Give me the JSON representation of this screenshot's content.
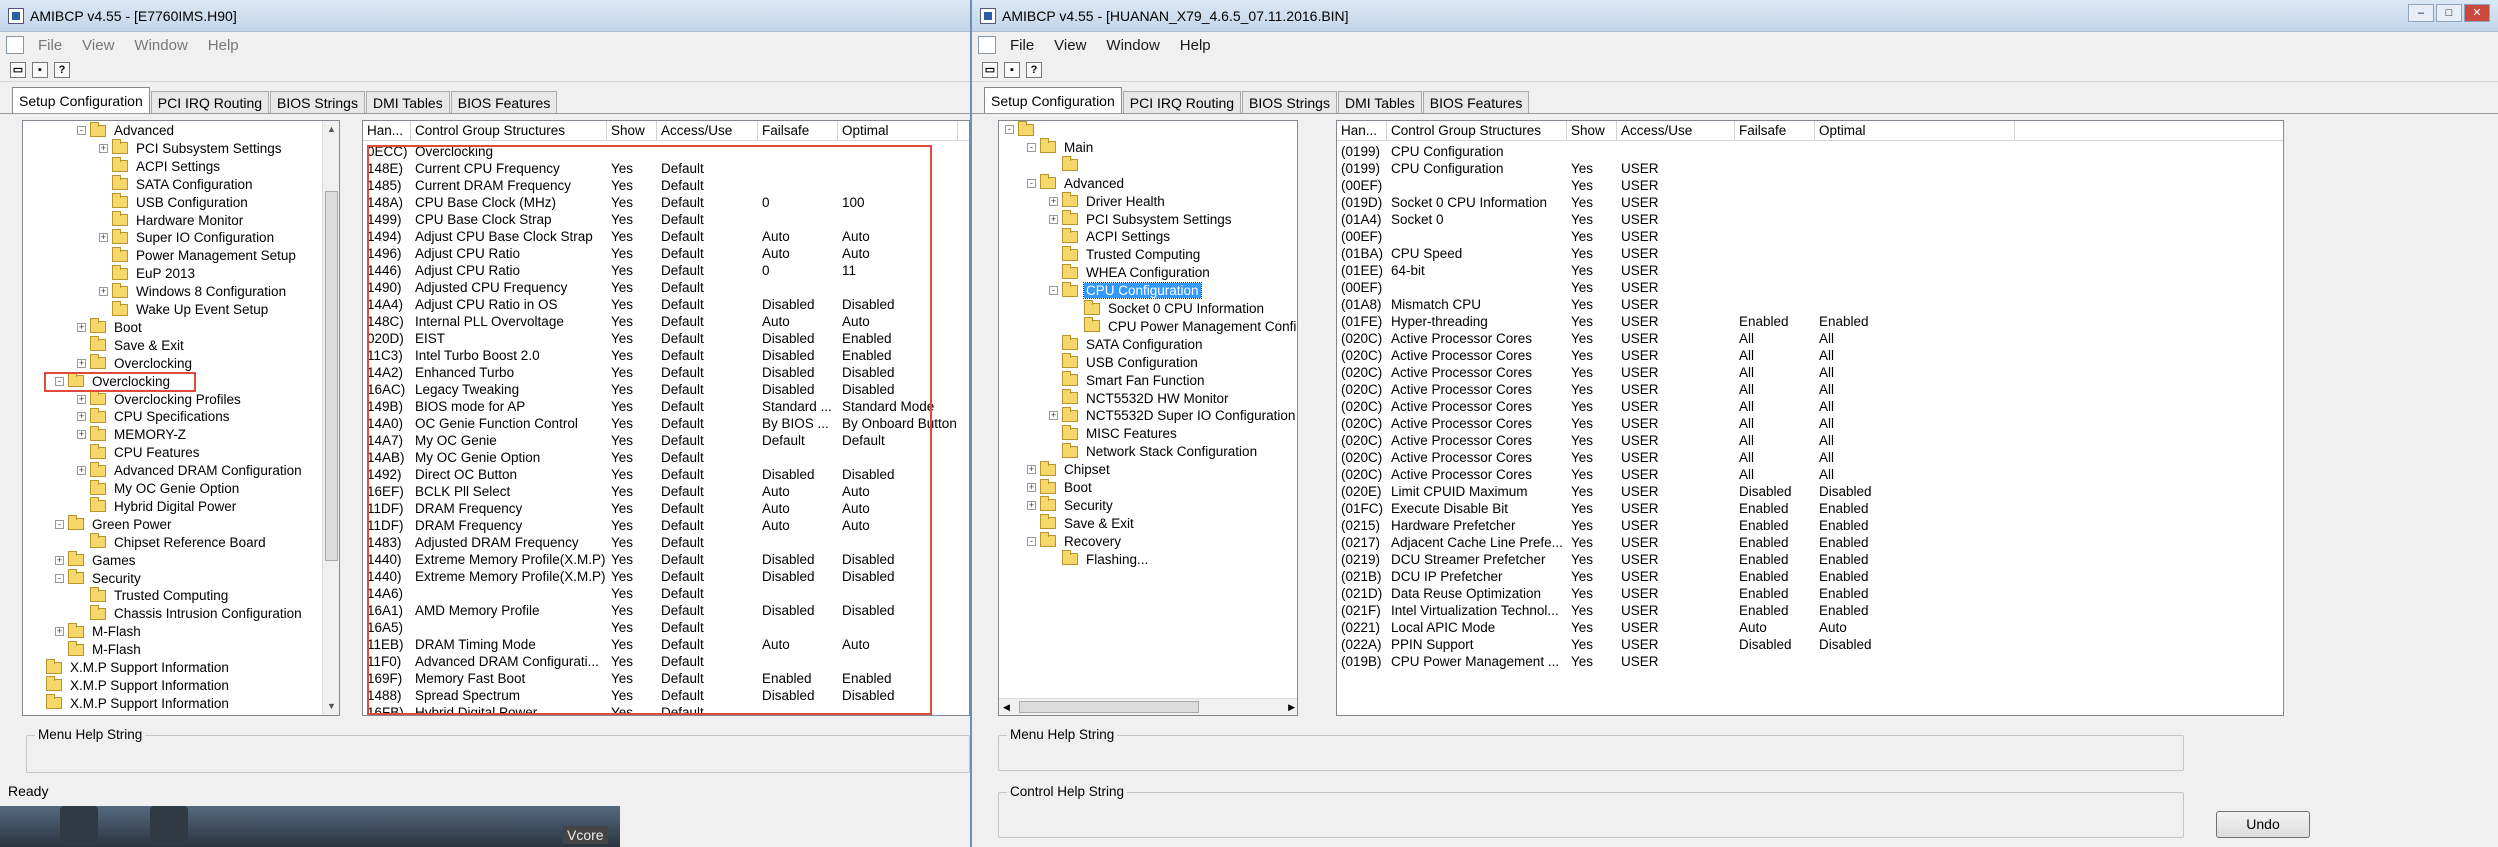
{
  "win1": {
    "title": "AMIBCP v4.55 - [E7760IMS.H90]",
    "menu": [
      "File",
      "View",
      "Window",
      "Help"
    ],
    "tabs": [
      "Setup Configuration",
      "PCI IRQ Routing",
      "BIOS Strings",
      "DMI Tables",
      "BIOS Features"
    ],
    "tree": [
      {
        "label": "Advanced",
        "level": 2,
        "exp": "-"
      },
      {
        "label": "PCI Subsystem Settings",
        "level": 3,
        "exp": "+"
      },
      {
        "label": "ACPI Settings",
        "level": 3,
        "exp": ""
      },
      {
        "label": "SATA Configuration",
        "level": 3,
        "exp": ""
      },
      {
        "label": "USB Configuration",
        "level": 3,
        "exp": ""
      },
      {
        "label": "Hardware Monitor",
        "level": 3,
        "exp": ""
      },
      {
        "label": "Super IO Configuration",
        "level": 3,
        "exp": "+"
      },
      {
        "label": "Power Management Setup",
        "level": 3,
        "exp": ""
      },
      {
        "label": "EuP 2013",
        "level": 3,
        "exp": ""
      },
      {
        "label": "Windows 8 Configuration",
        "level": 3,
        "exp": "+"
      },
      {
        "label": "Wake Up Event Setup",
        "level": 3,
        "exp": ""
      },
      {
        "label": "Boot",
        "level": 2,
        "exp": "+"
      },
      {
        "label": "Save & Exit",
        "level": 2,
        "exp": ""
      },
      {
        "label": "Overclocking",
        "level": 2,
        "exp": "+"
      },
      {
        "label": "Overclocking",
        "level": 1,
        "exp": "-"
      },
      {
        "label": "Overclocking Profiles",
        "level": 2,
        "exp": "+"
      },
      {
        "label": "CPU Specifications",
        "level": 2,
        "exp": "+"
      },
      {
        "label": "MEMORY-Z",
        "level": 2,
        "exp": "+"
      },
      {
        "label": "CPU Features",
        "level": 2,
        "exp": ""
      },
      {
        "label": "Advanced DRAM Configuration",
        "level": 2,
        "exp": "+"
      },
      {
        "label": "My OC Genie Option",
        "level": 2,
        "exp": ""
      },
      {
        "label": "Hybrid Digital Power",
        "level": 2,
        "exp": ""
      },
      {
        "label": "Green Power",
        "level": 1,
        "exp": "-"
      },
      {
        "label": "Chipset Reference Board",
        "level": 2,
        "exp": ""
      },
      {
        "label": "Games",
        "level": 1,
        "exp": "+"
      },
      {
        "label": "Security",
        "level": 1,
        "exp": "-"
      },
      {
        "label": "Trusted Computing",
        "level": 2,
        "exp": ""
      },
      {
        "label": "Chassis Intrusion Configuration",
        "level": 2,
        "exp": ""
      },
      {
        "label": "M-Flash",
        "level": 1,
        "exp": "+"
      },
      {
        "label": "M-Flash",
        "level": 1,
        "exp": ""
      },
      {
        "label": "X.M.P Support Information",
        "level": 0,
        "exp": ""
      },
      {
        "label": "X.M.P Support Information",
        "level": 0,
        "exp": ""
      },
      {
        "label": "X.M.P Support Information",
        "level": 0,
        "exp": ""
      }
    ],
    "columns": [
      "Han...",
      "Control Group Structures",
      "Show",
      "Access/Use",
      "Failsafe",
      "Optimal"
    ],
    "rows": [
      [
        "0ECC)",
        "Overclocking",
        "",
        "",
        "",
        ""
      ],
      [
        "148E)",
        "Current CPU Frequency",
        "Yes",
        "Default",
        "",
        ""
      ],
      [
        "1485)",
        "Current DRAM Frequency",
        "Yes",
        "Default",
        "",
        ""
      ],
      [
        "148A)",
        "CPU Base Clock (MHz)",
        "Yes",
        "Default",
        "0",
        "100"
      ],
      [
        "1499)",
        "CPU Base Clock Strap",
        "Yes",
        "Default",
        "",
        ""
      ],
      [
        "1494)",
        "Adjust CPU Base Clock Strap",
        "Yes",
        "Default",
        "Auto",
        "Auto"
      ],
      [
        "1496)",
        "Adjust CPU Ratio",
        "Yes",
        "Default",
        "Auto",
        "Auto"
      ],
      [
        "1446)",
        "Adjust CPU Ratio",
        "Yes",
        "Default",
        "0",
        "11"
      ],
      [
        "1490)",
        "Adjusted CPU Frequency",
        "Yes",
        "Default",
        "",
        ""
      ],
      [
        "14A4)",
        "Adjust CPU Ratio in OS",
        "Yes",
        "Default",
        "Disabled",
        "Disabled"
      ],
      [
        "148C)",
        "Internal PLL Overvoltage",
        "Yes",
        "Default",
        "Auto",
        "Auto"
      ],
      [
        "020D)",
        "EIST",
        "Yes",
        "Default",
        "Disabled",
        "Enabled"
      ],
      [
        "11C3)",
        "Intel Turbo Boost 2.0",
        "Yes",
        "Default",
        "Disabled",
        "Enabled"
      ],
      [
        "14A2)",
        "Enhanced Turbo",
        "Yes",
        "Default",
        "Disabled",
        "Disabled"
      ],
      [
        "16AC)",
        "Legacy Tweaking",
        "Yes",
        "Default",
        "Disabled",
        "Disabled"
      ],
      [
        "149B)",
        "BIOS mode for AP",
        "Yes",
        "Default",
        "Standard ...",
        "Standard Mode"
      ],
      [
        "14A0)",
        "OC Genie Function Control",
        "Yes",
        "Default",
        "By BIOS ...",
        "By Onboard Button"
      ],
      [
        "14A7)",
        "My OC Genie",
        "Yes",
        "Default",
        "Default",
        "Default"
      ],
      [
        "14AB)",
        "My OC Genie Option",
        "Yes",
        "Default",
        "",
        ""
      ],
      [
        "1492)",
        "Direct OC Button",
        "Yes",
        "Default",
        "Disabled",
        "Disabled"
      ],
      [
        "16EF)",
        "BCLK Pll Select",
        "Yes",
        "Default",
        "Auto",
        "Auto"
      ],
      [
        "11DF)",
        "DRAM Frequency",
        "Yes",
        "Default",
        "Auto",
        "Auto"
      ],
      [
        "11DF)",
        "DRAM Frequency",
        "Yes",
        "Default",
        "Auto",
        "Auto"
      ],
      [
        "1483)",
        "Adjusted DRAM Frequency",
        "Yes",
        "Default",
        "",
        ""
      ],
      [
        "1440)",
        "Extreme Memory Profile(X.M.P)",
        "Yes",
        "Default",
        "Disabled",
        "Disabled"
      ],
      [
        "1440)",
        "Extreme Memory Profile(X.M.P)",
        "Yes",
        "Default",
        "Disabled",
        "Disabled"
      ],
      [
        "14A6)",
        "",
        "Yes",
        "Default",
        "",
        ""
      ],
      [
        "16A1)",
        "AMD Memory Profile",
        "Yes",
        "Default",
        "Disabled",
        "Disabled"
      ],
      [
        "16A5)",
        "",
        "Yes",
        "Default",
        "",
        ""
      ],
      [
        "11EB)",
        "DRAM Timing Mode",
        "Yes",
        "Default",
        "Auto",
        "Auto"
      ],
      [
        "11F0)",
        "Advanced DRAM Configurati...",
        "Yes",
        "Default",
        "",
        ""
      ],
      [
        "169F)",
        "Memory Fast Boot",
        "Yes",
        "Default",
        "Enabled",
        "Enabled"
      ],
      [
        "1488)",
        "Spread Spectrum",
        "Yes",
        "Default",
        "Disabled",
        "Disabled"
      ],
      [
        "16FB)",
        "Hybrid Digital Power",
        "Yes",
        "Default",
        "",
        ""
      ]
    ],
    "menu_help_label": "Menu Help String",
    "status": "Ready",
    "taskbar_text": "Vcore"
  },
  "win2": {
    "title": "AMIBCP v4.55 - [HUANAN_X79_4.6.5_07.11.2016.BIN]",
    "menu": [
      "File",
      "View",
      "Window",
      "Help"
    ],
    "tabs": [
      "Setup Configuration",
      "PCI IRQ Routing",
      "BIOS Strings",
      "DMI Tables",
      "BIOS Features"
    ],
    "tree": [
      {
        "label": "",
        "level": 0,
        "exp": "-"
      },
      {
        "label": "Main",
        "level": 1,
        "exp": "-"
      },
      {
        "label": "",
        "level": 2,
        "exp": ""
      },
      {
        "label": "Advanced",
        "level": 1,
        "exp": "-"
      },
      {
        "label": "Driver Health",
        "level": 2,
        "exp": "+"
      },
      {
        "label": "PCI Subsystem Settings",
        "level": 2,
        "exp": "+"
      },
      {
        "label": "ACPI Settings",
        "level": 2,
        "exp": ""
      },
      {
        "label": "Trusted Computing",
        "level": 2,
        "exp": ""
      },
      {
        "label": "WHEA Configuration",
        "level": 2,
        "exp": ""
      },
      {
        "label": "CPU Configuration",
        "level": 2,
        "exp": "-",
        "selected": true
      },
      {
        "label": "Socket 0 CPU Information",
        "level": 3,
        "exp": ""
      },
      {
        "label": "CPU Power Management Configur",
        "level": 3,
        "exp": ""
      },
      {
        "label": "SATA Configuration",
        "level": 2,
        "exp": ""
      },
      {
        "label": "USB Configuration",
        "level": 2,
        "exp": ""
      },
      {
        "label": "Smart Fan Function",
        "level": 2,
        "exp": ""
      },
      {
        "label": "NCT5532D HW Monitor",
        "level": 2,
        "exp": ""
      },
      {
        "label": "NCT5532D Super IO Configuration",
        "level": 2,
        "exp": "+"
      },
      {
        "label": "MISC Features",
        "level": 2,
        "exp": ""
      },
      {
        "label": "Network Stack Configuration",
        "level": 2,
        "exp": ""
      },
      {
        "label": "Chipset",
        "level": 1,
        "exp": "+"
      },
      {
        "label": "Boot",
        "level": 1,
        "exp": "+"
      },
      {
        "label": "Security",
        "level": 1,
        "exp": "+"
      },
      {
        "label": "Save & Exit",
        "level": 1,
        "exp": ""
      },
      {
        "label": "Recovery",
        "level": 1,
        "exp": "-"
      },
      {
        "label": "Flashing...",
        "level": 2,
        "exp": ""
      }
    ],
    "columns": [
      "Han...",
      "Control Group Structures",
      "Show",
      "Access/Use",
      "Failsafe",
      "Optimal"
    ],
    "rows": [
      [
        "(0199)",
        "CPU Configuration",
        "",
        "",
        "",
        ""
      ],
      [
        "(0199)",
        "CPU Configuration",
        "Yes",
        "USER",
        "",
        ""
      ],
      [
        "(00EF)",
        "",
        "Yes",
        "USER",
        "",
        ""
      ],
      [
        "(019D)",
        "Socket 0 CPU Information",
        "Yes",
        "USER",
        "",
        ""
      ],
      [
        "(01A4)",
        "Socket 0",
        "Yes",
        "USER",
        "",
        ""
      ],
      [
        "(00EF)",
        "",
        "Yes",
        "USER",
        "",
        ""
      ],
      [
        "(01BA)",
        "CPU Speed",
        "Yes",
        "USER",
        "",
        ""
      ],
      [
        "(01EE)",
        "64-bit",
        "Yes",
        "USER",
        "",
        ""
      ],
      [
        "(00EF)",
        "",
        "Yes",
        "USER",
        "",
        ""
      ],
      [
        "(01A8)",
        "Mismatch CPU",
        "Yes",
        "USER",
        "",
        ""
      ],
      [
        "(01FE)",
        "Hyper-threading",
        "Yes",
        "USER",
        "Enabled",
        "Enabled"
      ],
      [
        "(020C)",
        "Active Processor Cores",
        "Yes",
        "USER",
        "All",
        "All"
      ],
      [
        "(020C)",
        "Active Processor Cores",
        "Yes",
        "USER",
        "All",
        "All"
      ],
      [
        "(020C)",
        "Active Processor Cores",
        "Yes",
        "USER",
        "All",
        "All"
      ],
      [
        "(020C)",
        "Active Processor Cores",
        "Yes",
        "USER",
        "All",
        "All"
      ],
      [
        "(020C)",
        "Active Processor Cores",
        "Yes",
        "USER",
        "All",
        "All"
      ],
      [
        "(020C)",
        "Active Processor Cores",
        "Yes",
        "USER",
        "All",
        "All"
      ],
      [
        "(020C)",
        "Active Processor Cores",
        "Yes",
        "USER",
        "All",
        "All"
      ],
      [
        "(020C)",
        "Active Processor Cores",
        "Yes",
        "USER",
        "All",
        "All"
      ],
      [
        "(020C)",
        "Active Processor Cores",
        "Yes",
        "USER",
        "All",
        "All"
      ],
      [
        "(020E)",
        "Limit CPUID Maximum",
        "Yes",
        "USER",
        "Disabled",
        "Disabled"
      ],
      [
        "(01FC)",
        "Execute Disable Bit",
        "Yes",
        "USER",
        "Enabled",
        "Enabled"
      ],
      [
        "(0215)",
        "Hardware Prefetcher",
        "Yes",
        "USER",
        "Enabled",
        "Enabled"
      ],
      [
        "(0217)",
        "Adjacent Cache Line Prefe...",
        "Yes",
        "USER",
        "Enabled",
        "Enabled"
      ],
      [
        "(0219)",
        "DCU Streamer Prefetcher",
        "Yes",
        "USER",
        "Enabled",
        "Enabled"
      ],
      [
        "(021B)",
        "DCU IP Prefetcher",
        "Yes",
        "USER",
        "Enabled",
        "Enabled"
      ],
      [
        "(021D)",
        "Data Reuse Optimization",
        "Yes",
        "USER",
        "Enabled",
        "Enabled"
      ],
      [
        "(021F)",
        "Intel Virtualization Technol...",
        "Yes",
        "USER",
        "Enabled",
        "Enabled"
      ],
      [
        "(0221)",
        "Local APIC Mode",
        "Yes",
        "USER",
        "Auto",
        "Auto"
      ],
      [
        "(022A)",
        "PPIN Support",
        "Yes",
        "USER",
        "Disabled",
        "Disabled"
      ],
      [
        "(019B)",
        "CPU Power Management ...",
        "Yes",
        "USER",
        "",
        ""
      ]
    ],
    "menu_help_label": "Menu Help String",
    "control_help_label": "Control Help String",
    "undo_label": "Undo"
  },
  "colors": {
    "highlight": "#e04a3a",
    "selection": "#3399ff"
  }
}
